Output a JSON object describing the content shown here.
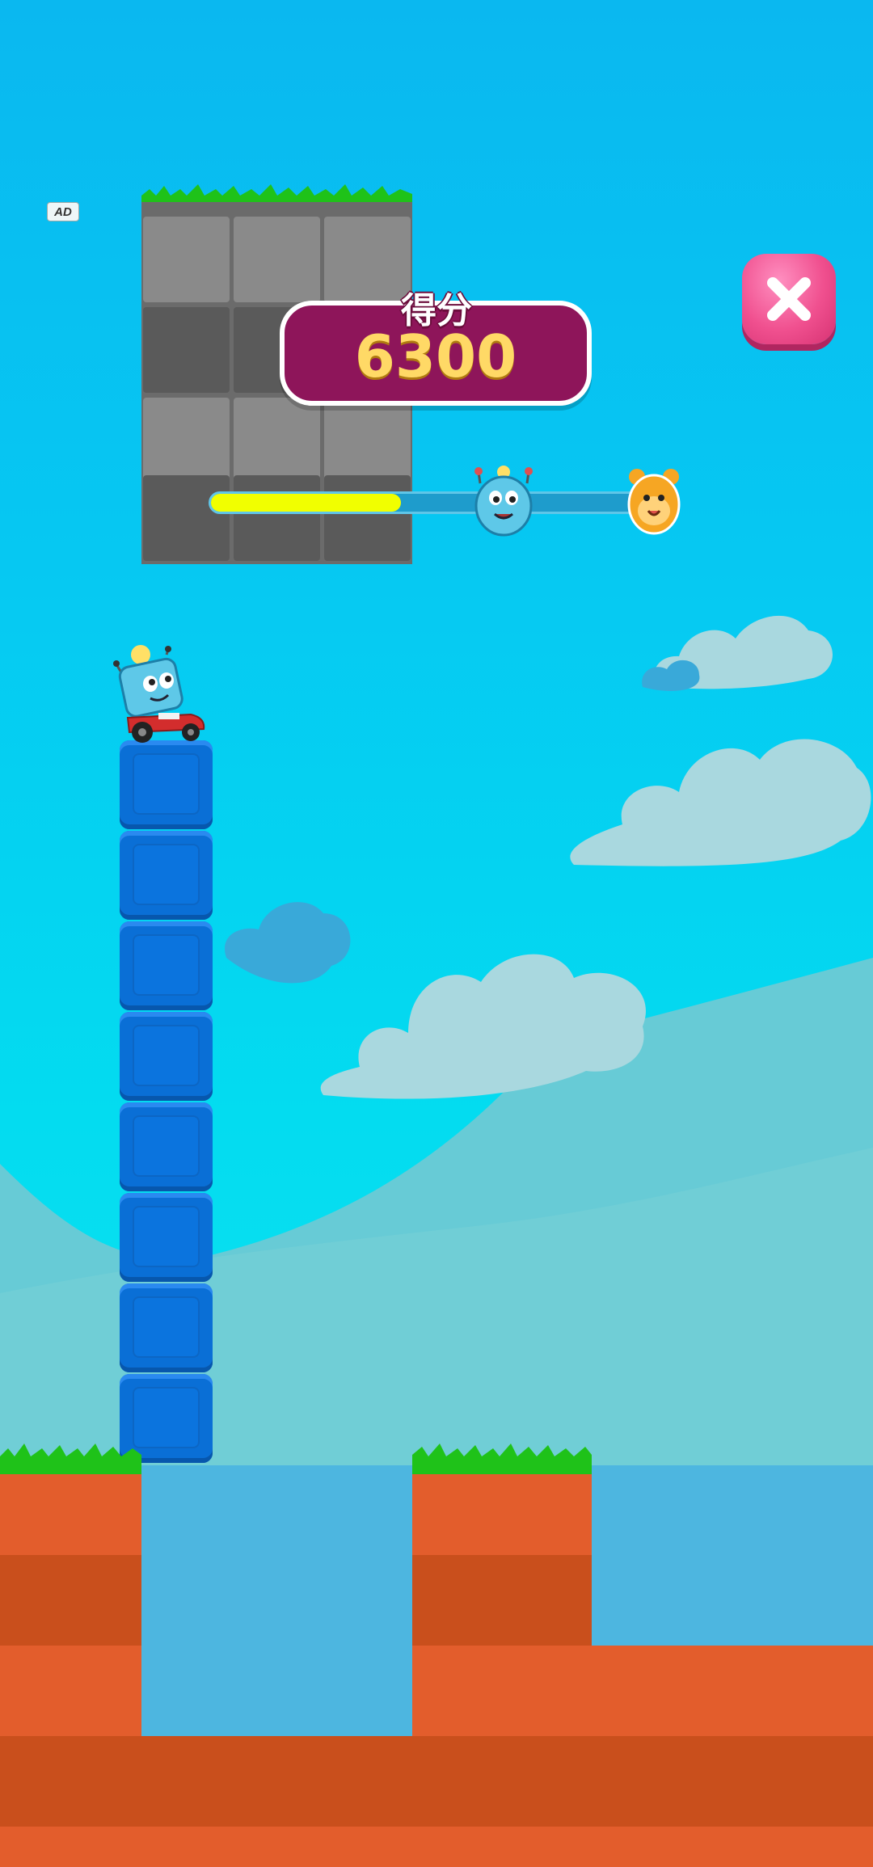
{
  "ad_badge": "AD",
  "score": {
    "label": "得分",
    "value": "6300"
  },
  "progress": {
    "fraction": 0.44,
    "fill_color": "#f1ff00"
  },
  "tower": {
    "block_count": 8,
    "block_color": "#0a6fd6"
  },
  "icons": {
    "close": "close-icon",
    "player_avatar": "blue-robot-avatar",
    "rival_avatar": "orange-hamster-avatar",
    "player": "robot-on-kart"
  },
  "colors": {
    "sky": "#06c8f2",
    "score_pill": "#8e155a",
    "score_text": "#ffd966",
    "close_button": "#f0508f",
    "dirt": "#e35d2c",
    "water": "#4db6e0",
    "grass": "#1fc219"
  }
}
